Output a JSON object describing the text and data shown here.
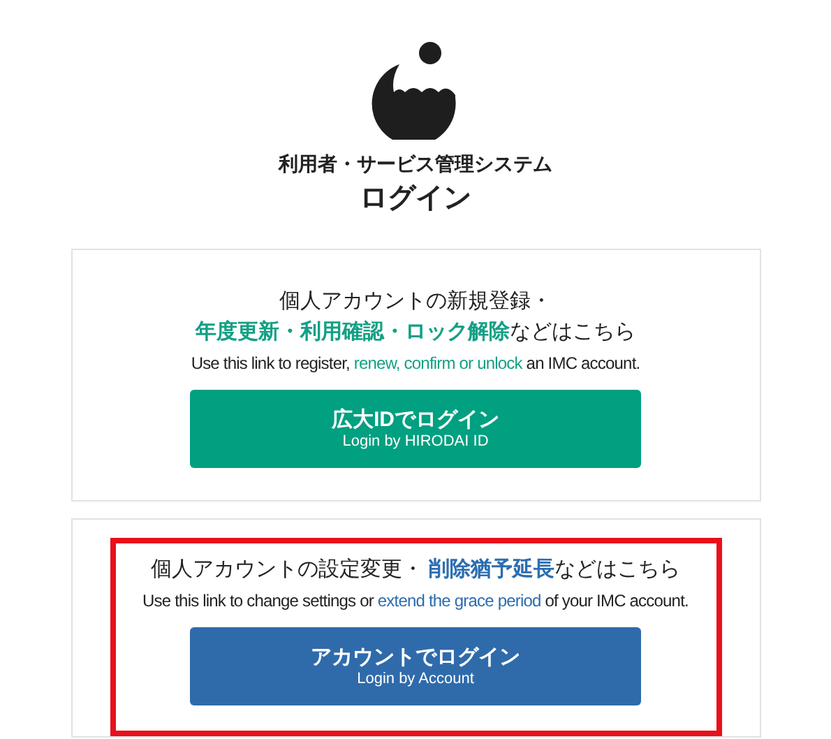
{
  "header": {
    "subtitle": "利用者・サービス管理システム",
    "title": "ログイン"
  },
  "cards": [
    {
      "highlighted": false,
      "kind": "green",
      "lines": [
        [
          {
            "text": "個人アカウントの新規登録・",
            "accent": false
          }
        ],
        [
          {
            "text": "年度更新・利用確認・ロック解除",
            "accent": true
          },
          {
            "text": "などはこちら",
            "accent": false
          }
        ],
        [
          {
            "text": "Use this link to register, ",
            "accent": false
          },
          {
            "text": "renew, confirm or unlock",
            "accent": true
          },
          {
            "text": " an IMC account.",
            "accent": false
          }
        ]
      ],
      "button": {
        "label": "広大IDでログイン",
        "sublabel": "Login by HIRODAI ID"
      }
    },
    {
      "highlighted": true,
      "kind": "blue",
      "lines": [
        [
          {
            "text": "個人アカウントの設定変更・ ",
            "accent": false
          },
          {
            "text": "削除猶予延長",
            "accent": true
          },
          {
            "text": "などはこちら",
            "accent": false
          }
        ],
        [
          {
            "text": "Use this link to change settings or ",
            "accent": false
          },
          {
            "text": "extend the grace period",
            "accent": true
          },
          {
            "text": " of your IMC account.",
            "accent": false
          }
        ]
      ],
      "button": {
        "label": "アカウントでログイン",
        "sublabel": "Login by Account"
      }
    }
  ]
}
